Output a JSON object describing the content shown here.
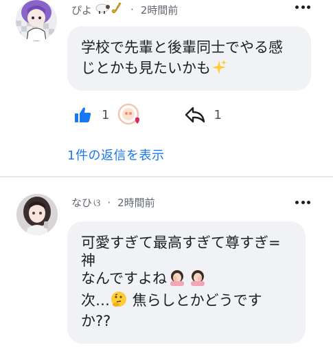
{
  "comments": [
    {
      "author": "ぴよ",
      "time": "2時間前",
      "lines": [
        "学校で先輩と後輩同士でやる感",
        "じとかも見たいかも"
      ],
      "likes": "1",
      "replies_count": "1",
      "view_replies_label": "1件の返信を表示",
      "icons": [
        "sheep-emoji",
        "saxophone-emoji",
        "sparkles-emoji",
        "thumbs-up-icon",
        "care-reaction-icon",
        "share-icon",
        "more-icon"
      ]
    },
    {
      "author": "なひ",
      "author_suffix": "ଓ",
      "time": "2時間前",
      "lines": [
        "可愛すぎて最高すぎて尊すぎ=",
        "神",
        "なんですよね",
        "次…",
        " 焦らしとかどうです",
        "か??"
      ],
      "icons": [
        "face-palm-emoji",
        "thinking-face-emoji",
        "more-icon"
      ]
    }
  ],
  "colors": {
    "accent": "#1877f2",
    "bubble": "#f0f2f5",
    "meta": "#606770"
  }
}
